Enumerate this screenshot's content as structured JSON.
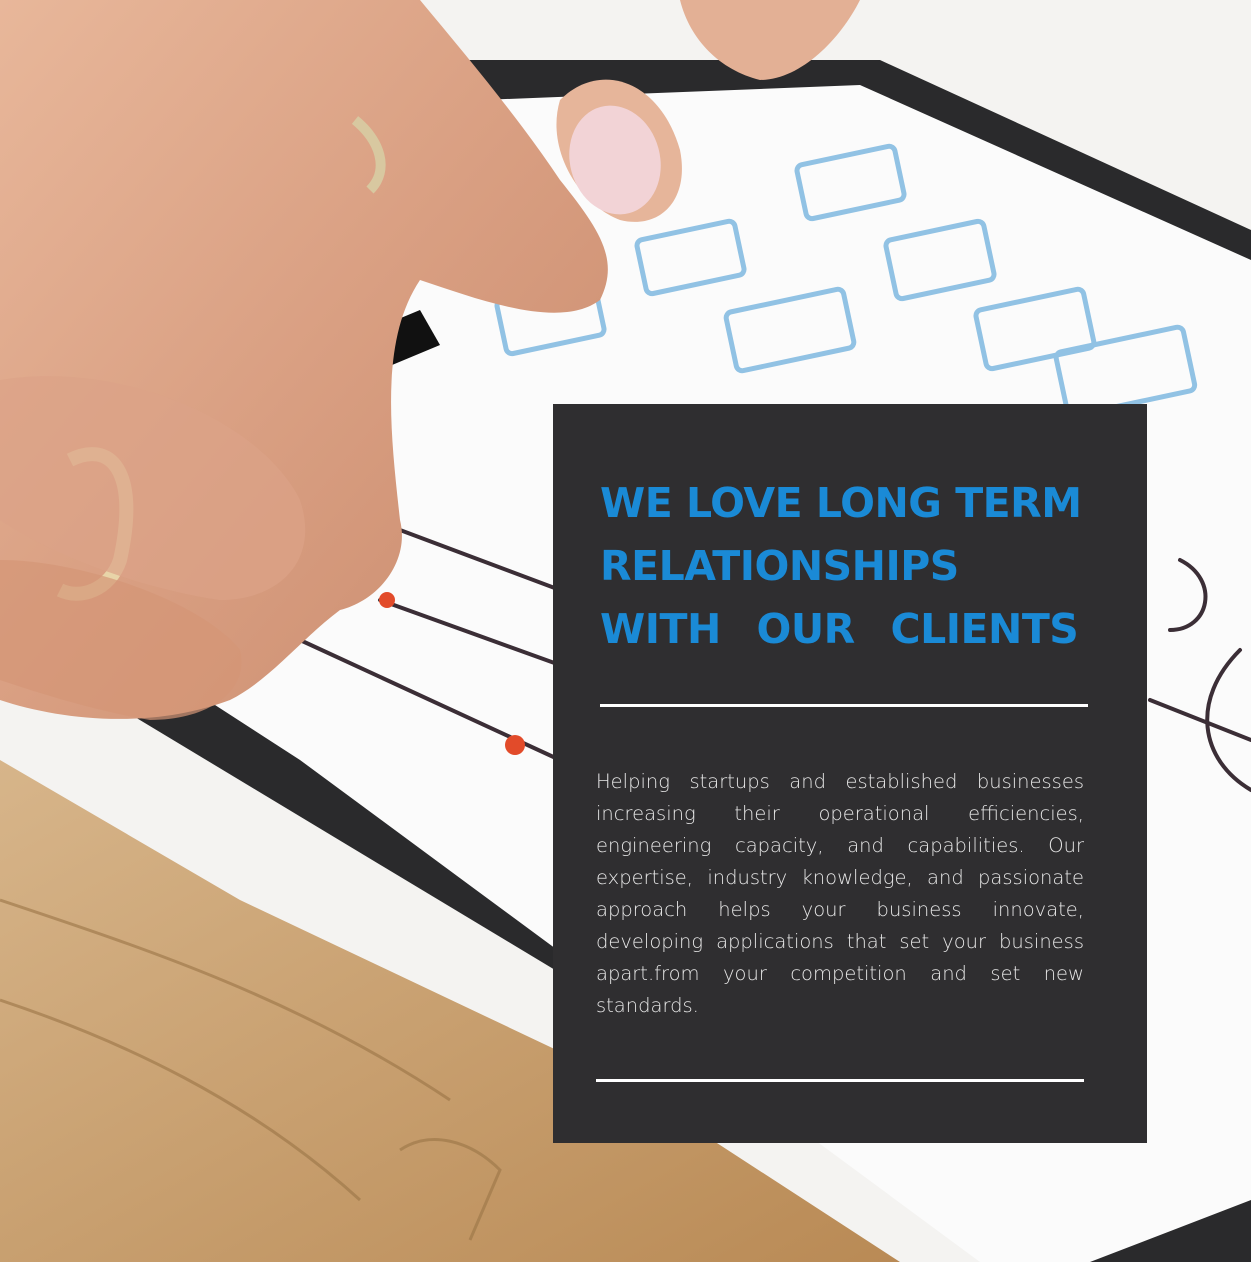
{
  "card": {
    "heading_lines": [
      "WE LOVE LONG TERM",
      "RELATIONSHIPS",
      "WITH OUR CLIENTS"
    ],
    "body": "Helping startups and established businesses increasing their operational efficiencies, engineering capacity, and capabilities. Our expertise, industry knowledge, and passionate approach helps your business innovate, developing applications that set your business apart.from your competition and set new standards."
  },
  "colors": {
    "accent": "#1a8ad6",
    "card_background": "#2f2e30",
    "body_text": "#e7e7e7"
  },
  "image": {
    "subject": "hands-sketching-wireframe-on-tablet"
  }
}
